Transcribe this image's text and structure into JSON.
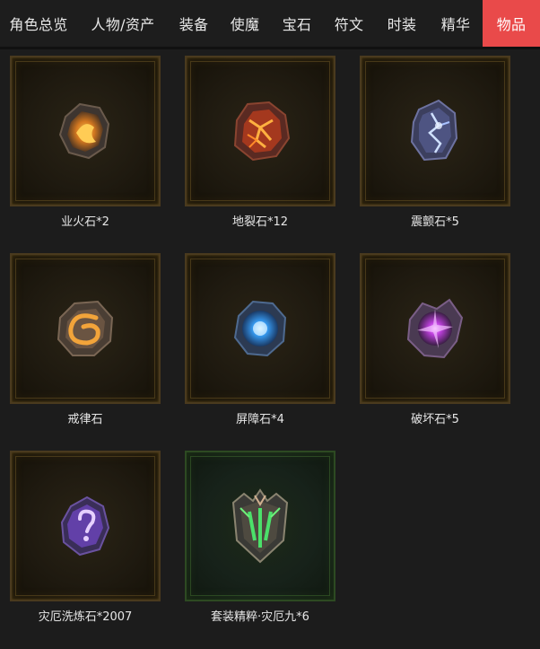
{
  "tabs": [
    {
      "label": "角色总览",
      "active": false
    },
    {
      "label": "人物/资产",
      "active": false
    },
    {
      "label": "装备",
      "active": false
    },
    {
      "label": "使魔",
      "active": false
    },
    {
      "label": "宝石",
      "active": false
    },
    {
      "label": "符文",
      "active": false
    },
    {
      "label": "时装",
      "active": false
    },
    {
      "label": "精华",
      "active": false
    },
    {
      "label": "物品",
      "active": true
    }
  ],
  "accent_color": "#e94a4a",
  "items": [
    {
      "name": "业火石*2",
      "icon": "fire-stone-icon"
    },
    {
      "name": "地裂石*12",
      "icon": "earth-crack-stone-icon"
    },
    {
      "name": "震颤石*5",
      "icon": "tremor-stone-icon"
    },
    {
      "name": "戒律石",
      "icon": "discipline-stone-icon"
    },
    {
      "name": "屏障石*4",
      "icon": "barrier-stone-icon"
    },
    {
      "name": "破坏石*5",
      "icon": "destruction-stone-icon"
    },
    {
      "name": "灾厄洗炼石*2007",
      "icon": "calamity-refine-stone-icon"
    },
    {
      "name": "套装精粹·灾厄九*6",
      "icon": "set-essence-icon"
    }
  ]
}
